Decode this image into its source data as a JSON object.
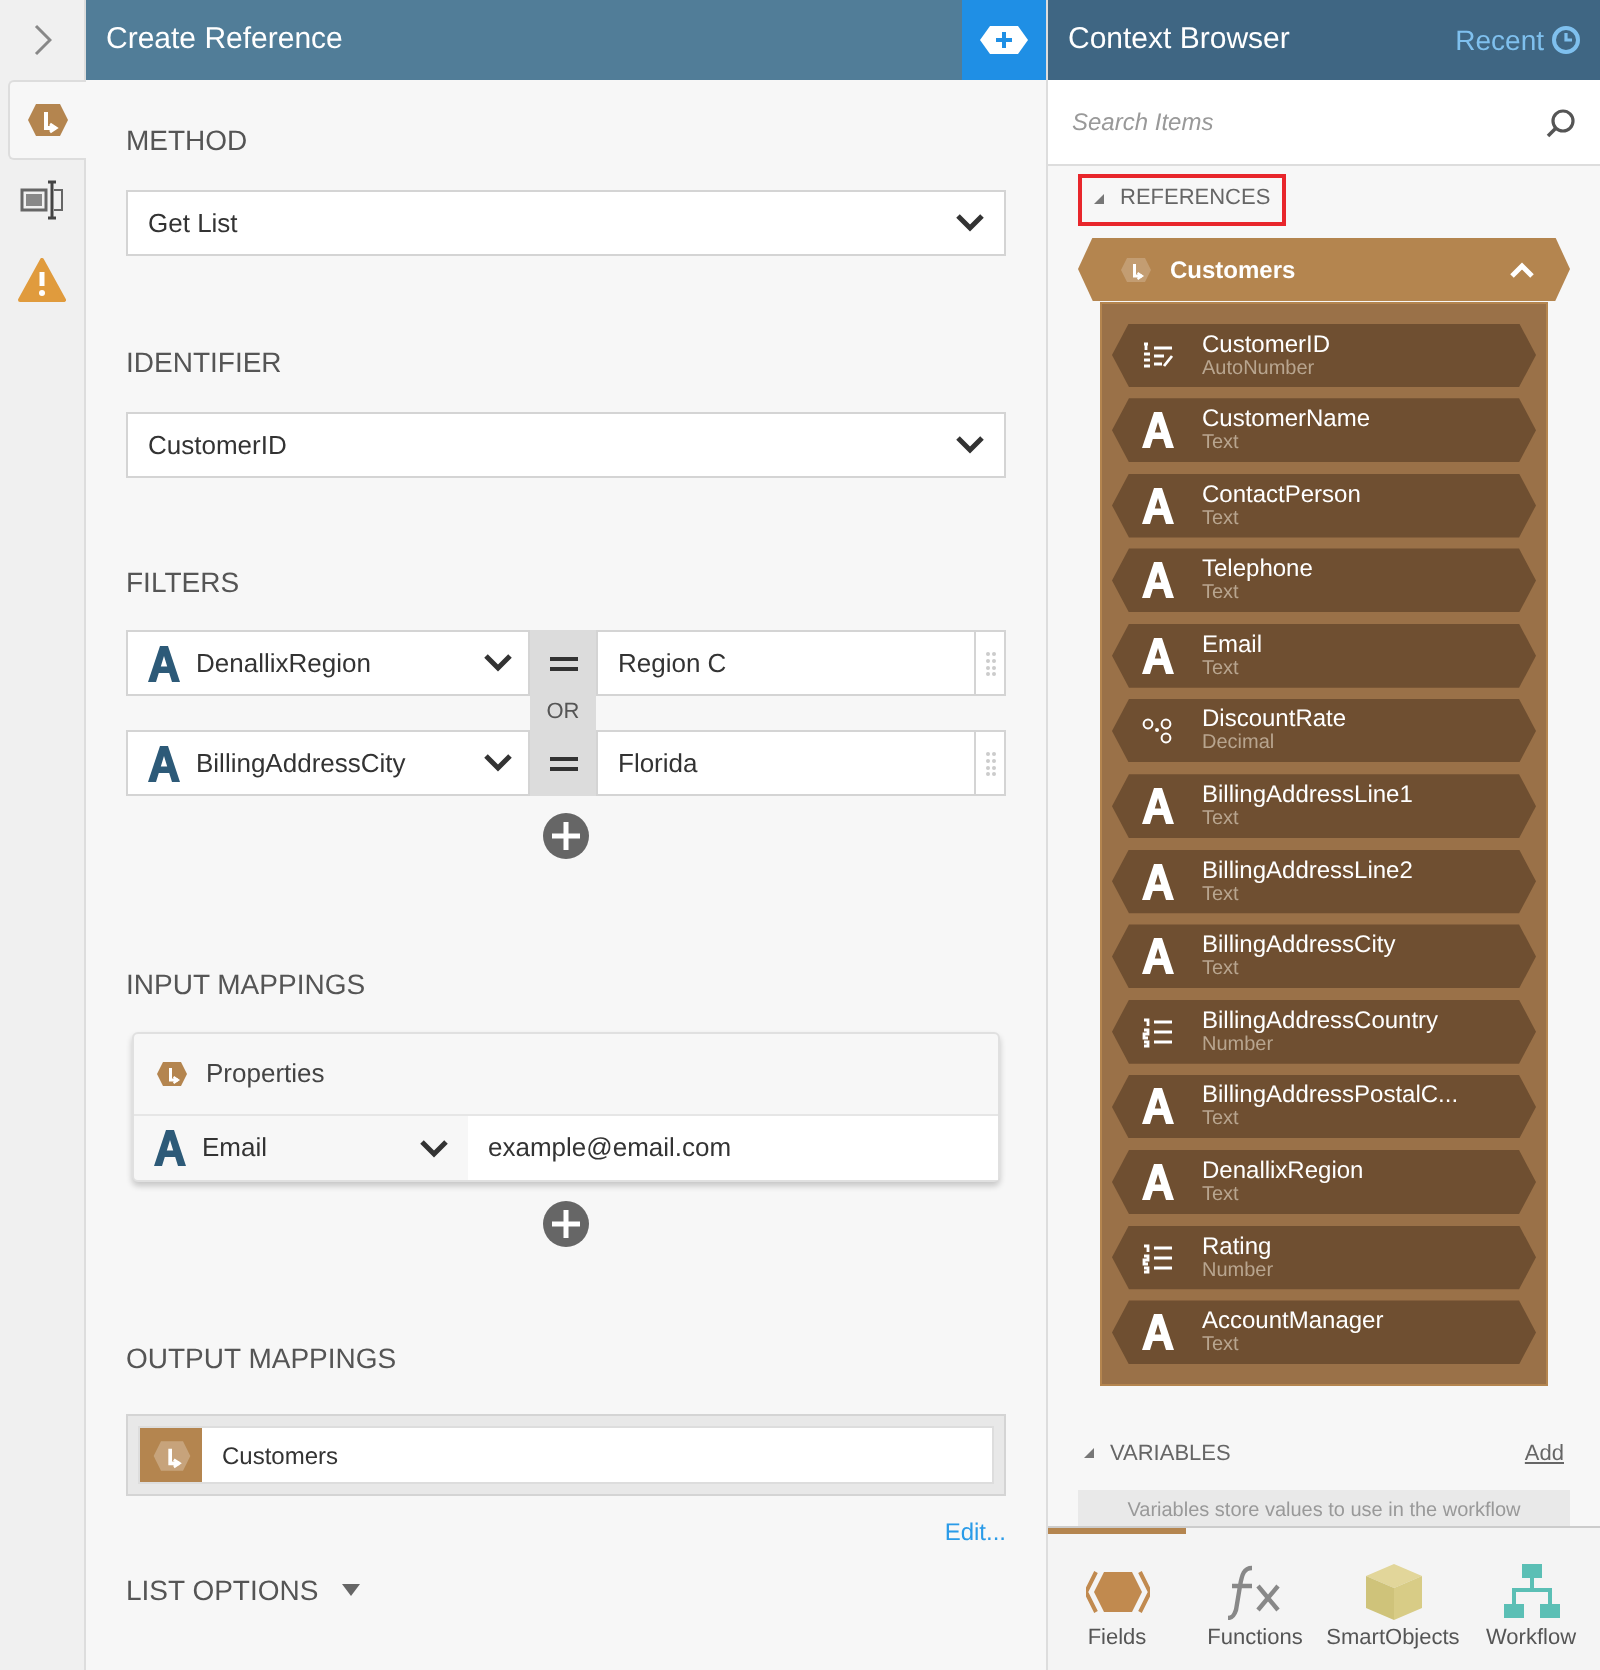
{
  "rail": {
    "items": [
      {
        "kind": "reference",
        "selected": true
      },
      {
        "kind": "form",
        "selected": false
      },
      {
        "kind": "warning",
        "selected": false
      }
    ]
  },
  "panel": {
    "title": "Create Reference",
    "method": {
      "label": "METHOD",
      "value": "Get List"
    },
    "identifier": {
      "label": "IDENTIFIER",
      "value": "CustomerID"
    },
    "filters": {
      "label": "FILTERS",
      "operator": "OR",
      "rows": [
        {
          "field": "DenallixRegion",
          "value": "Region C"
        },
        {
          "field": "BillingAddressCity",
          "value": "Florida"
        }
      ]
    },
    "input_mappings": {
      "label": "INPUT MAPPINGS",
      "header": "Properties",
      "rows": [
        {
          "field": "Email",
          "value": "example@email.com"
        }
      ]
    },
    "output_mappings": {
      "label": "OUTPUT MAPPINGS",
      "value": "Customers",
      "link": "Edit..."
    },
    "list_options": {
      "label": "LIST OPTIONS"
    }
  },
  "context_browser": {
    "title": "Context Browser",
    "recent": "Recent",
    "search": {
      "placeholder": "Search Items"
    },
    "references": {
      "label": "REFERENCES",
      "highlighted": true,
      "group": {
        "name": "Customers",
        "expanded": true,
        "fields": [
          {
            "name": "CustomerID",
            "type": "AutoNumber",
            "kind": "autonumber"
          },
          {
            "name": "CustomerName",
            "type": "Text",
            "kind": "text"
          },
          {
            "name": "ContactPerson",
            "type": "Text",
            "kind": "text"
          },
          {
            "name": "Telephone",
            "type": "Text",
            "kind": "text"
          },
          {
            "name": "Email",
            "type": "Text",
            "kind": "text"
          },
          {
            "name": "DiscountRate",
            "type": "Decimal",
            "kind": "decimal"
          },
          {
            "name": "BillingAddressLine1",
            "type": "Text",
            "kind": "text"
          },
          {
            "name": "BillingAddressLine2",
            "type": "Text",
            "kind": "text"
          },
          {
            "name": "BillingAddressCity",
            "type": "Text",
            "kind": "text"
          },
          {
            "name": "BillingAddressCountry",
            "type": "Number",
            "kind": "number"
          },
          {
            "name": "BillingAddressPostalC...",
            "type": "Text",
            "kind": "text"
          },
          {
            "name": "DenallixRegion",
            "type": "Text",
            "kind": "text"
          },
          {
            "name": "Rating",
            "type": "Number",
            "kind": "number"
          },
          {
            "name": "AccountManager",
            "type": "Text",
            "kind": "text"
          }
        ]
      }
    },
    "variables": {
      "label": "VARIABLES",
      "add": "Add",
      "hint": "Variables store values to use in the workflow"
    },
    "tabs": [
      {
        "label": "Fields",
        "kind": "fields",
        "selected": true
      },
      {
        "label": "Functions",
        "kind": "functions",
        "selected": false
      },
      {
        "label": "SmartObjects",
        "kind": "smartobjects",
        "selected": false
      },
      {
        "label": "Workflow",
        "kind": "workflow",
        "selected": false
      }
    ]
  }
}
